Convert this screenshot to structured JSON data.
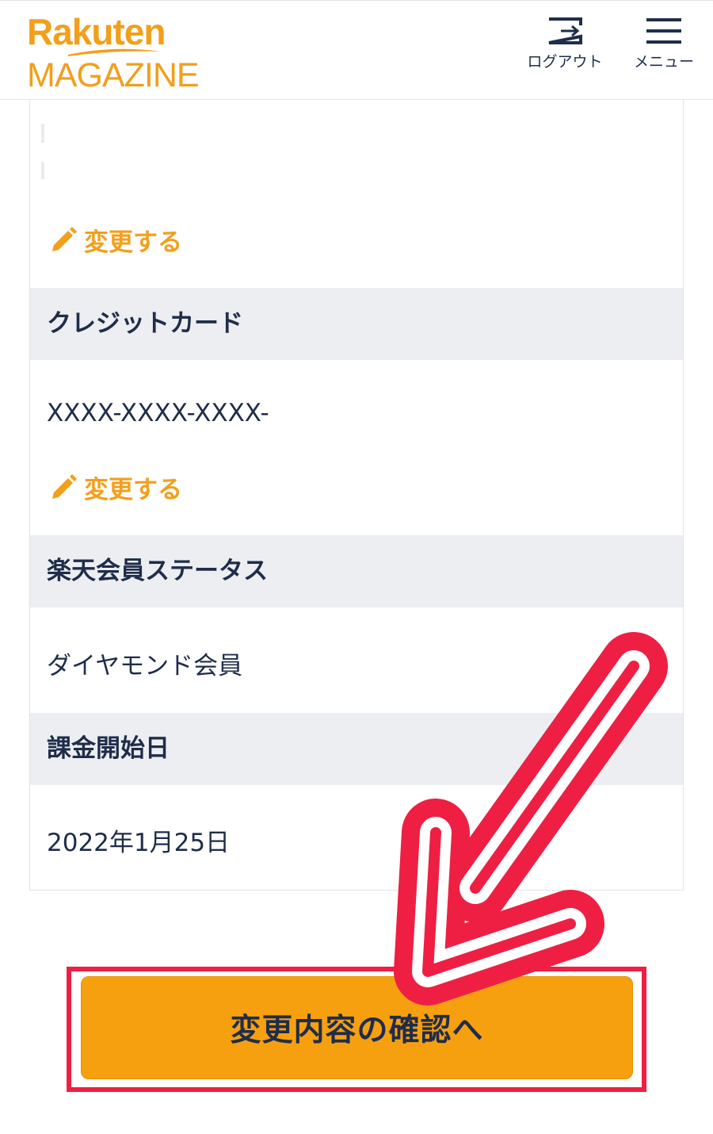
{
  "header": {
    "logo_line1": "Rakuten",
    "logo_line2": "MAGAZINE",
    "logout_label": "ログアウト",
    "menu_label": "メニュー"
  },
  "sections": {
    "edit_label_1": "変更する",
    "credit_card": {
      "title": "クレジットカード",
      "value": "XXXX-XXXX-XXXX-",
      "edit_label": "変更する"
    },
    "member_status": {
      "title": "楽天会員ステータス",
      "value": "ダイヤモンド会員"
    },
    "billing_start": {
      "title": "課金開始日",
      "value": "2022年1月25日"
    }
  },
  "confirm_button_label": "変更内容の確認へ",
  "colors": {
    "brand_orange": "#f29f1b",
    "button_orange": "#f7a00f",
    "text_navy": "#1f2d4a",
    "section_bg": "#eceef1",
    "highlight_red": "#ef1f43"
  }
}
